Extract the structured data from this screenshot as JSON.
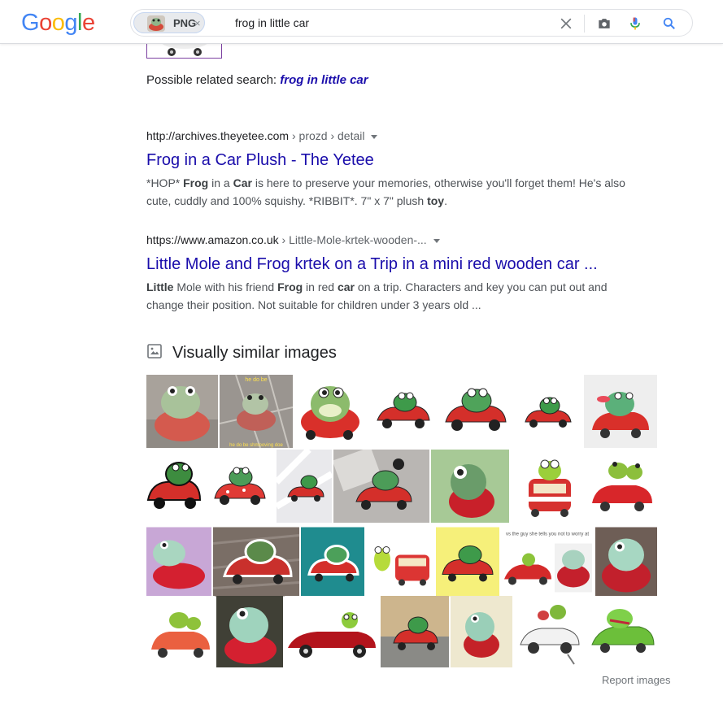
{
  "header": {
    "logo": [
      "G",
      "o",
      "o",
      "g",
      "l",
      "e"
    ],
    "logo_colors": [
      "#4285F4",
      "#EA4335",
      "#FBBC05",
      "#4285F4",
      "#34A853",
      "#EA4335"
    ],
    "chip_label": "PNG",
    "chip_close": "×",
    "query": "frog in little car"
  },
  "related": {
    "prefix": "Possible related search:",
    "link": "frog in little car"
  },
  "results": [
    {
      "url": "http://archives.theyetee.com",
      "crumbs": " › prozd › detail",
      "title": "Frog in a Car Plush - The Yetee",
      "snippet": [
        {
          "t": "*HOP* ",
          "b": false
        },
        {
          "t": "Frog",
          "b": true
        },
        {
          "t": " in a ",
          "b": false
        },
        {
          "t": "Car",
          "b": true
        },
        {
          "t": " is here to preserve your memories, otherwise you'll forget them! He's also cute, cuddly and 100% squishy. *RIBBIT*. 7\" x 7\" plush ",
          "b": false
        },
        {
          "t": "toy",
          "b": true
        },
        {
          "t": ".",
          "b": false
        }
      ]
    },
    {
      "url": "https://www.amazon.co.uk",
      "crumbs": " › Little-Mole-krtek-wooden-...",
      "title": "Little Mole and Frog krtek on a Trip in a mini red wooden car ...",
      "snippet": [
        {
          "t": "Little",
          "b": true
        },
        {
          "t": " Mole with his friend ",
          "b": false
        },
        {
          "t": "Frog",
          "b": true
        },
        {
          "t": " in red ",
          "b": false
        },
        {
          "t": "car",
          "b": true
        },
        {
          "t": " on a trip. Characters and key you can put out and change their position. Not suitable for children under 3 years old ...",
          "b": false
        }
      ]
    }
  ],
  "visually_similar": {
    "title": "Visually similar images",
    "image_captions": [
      "he do be",
      "he do be shmooving doe",
      "vs the guy she tells you not to worry at"
    ],
    "report": "Report images"
  }
}
